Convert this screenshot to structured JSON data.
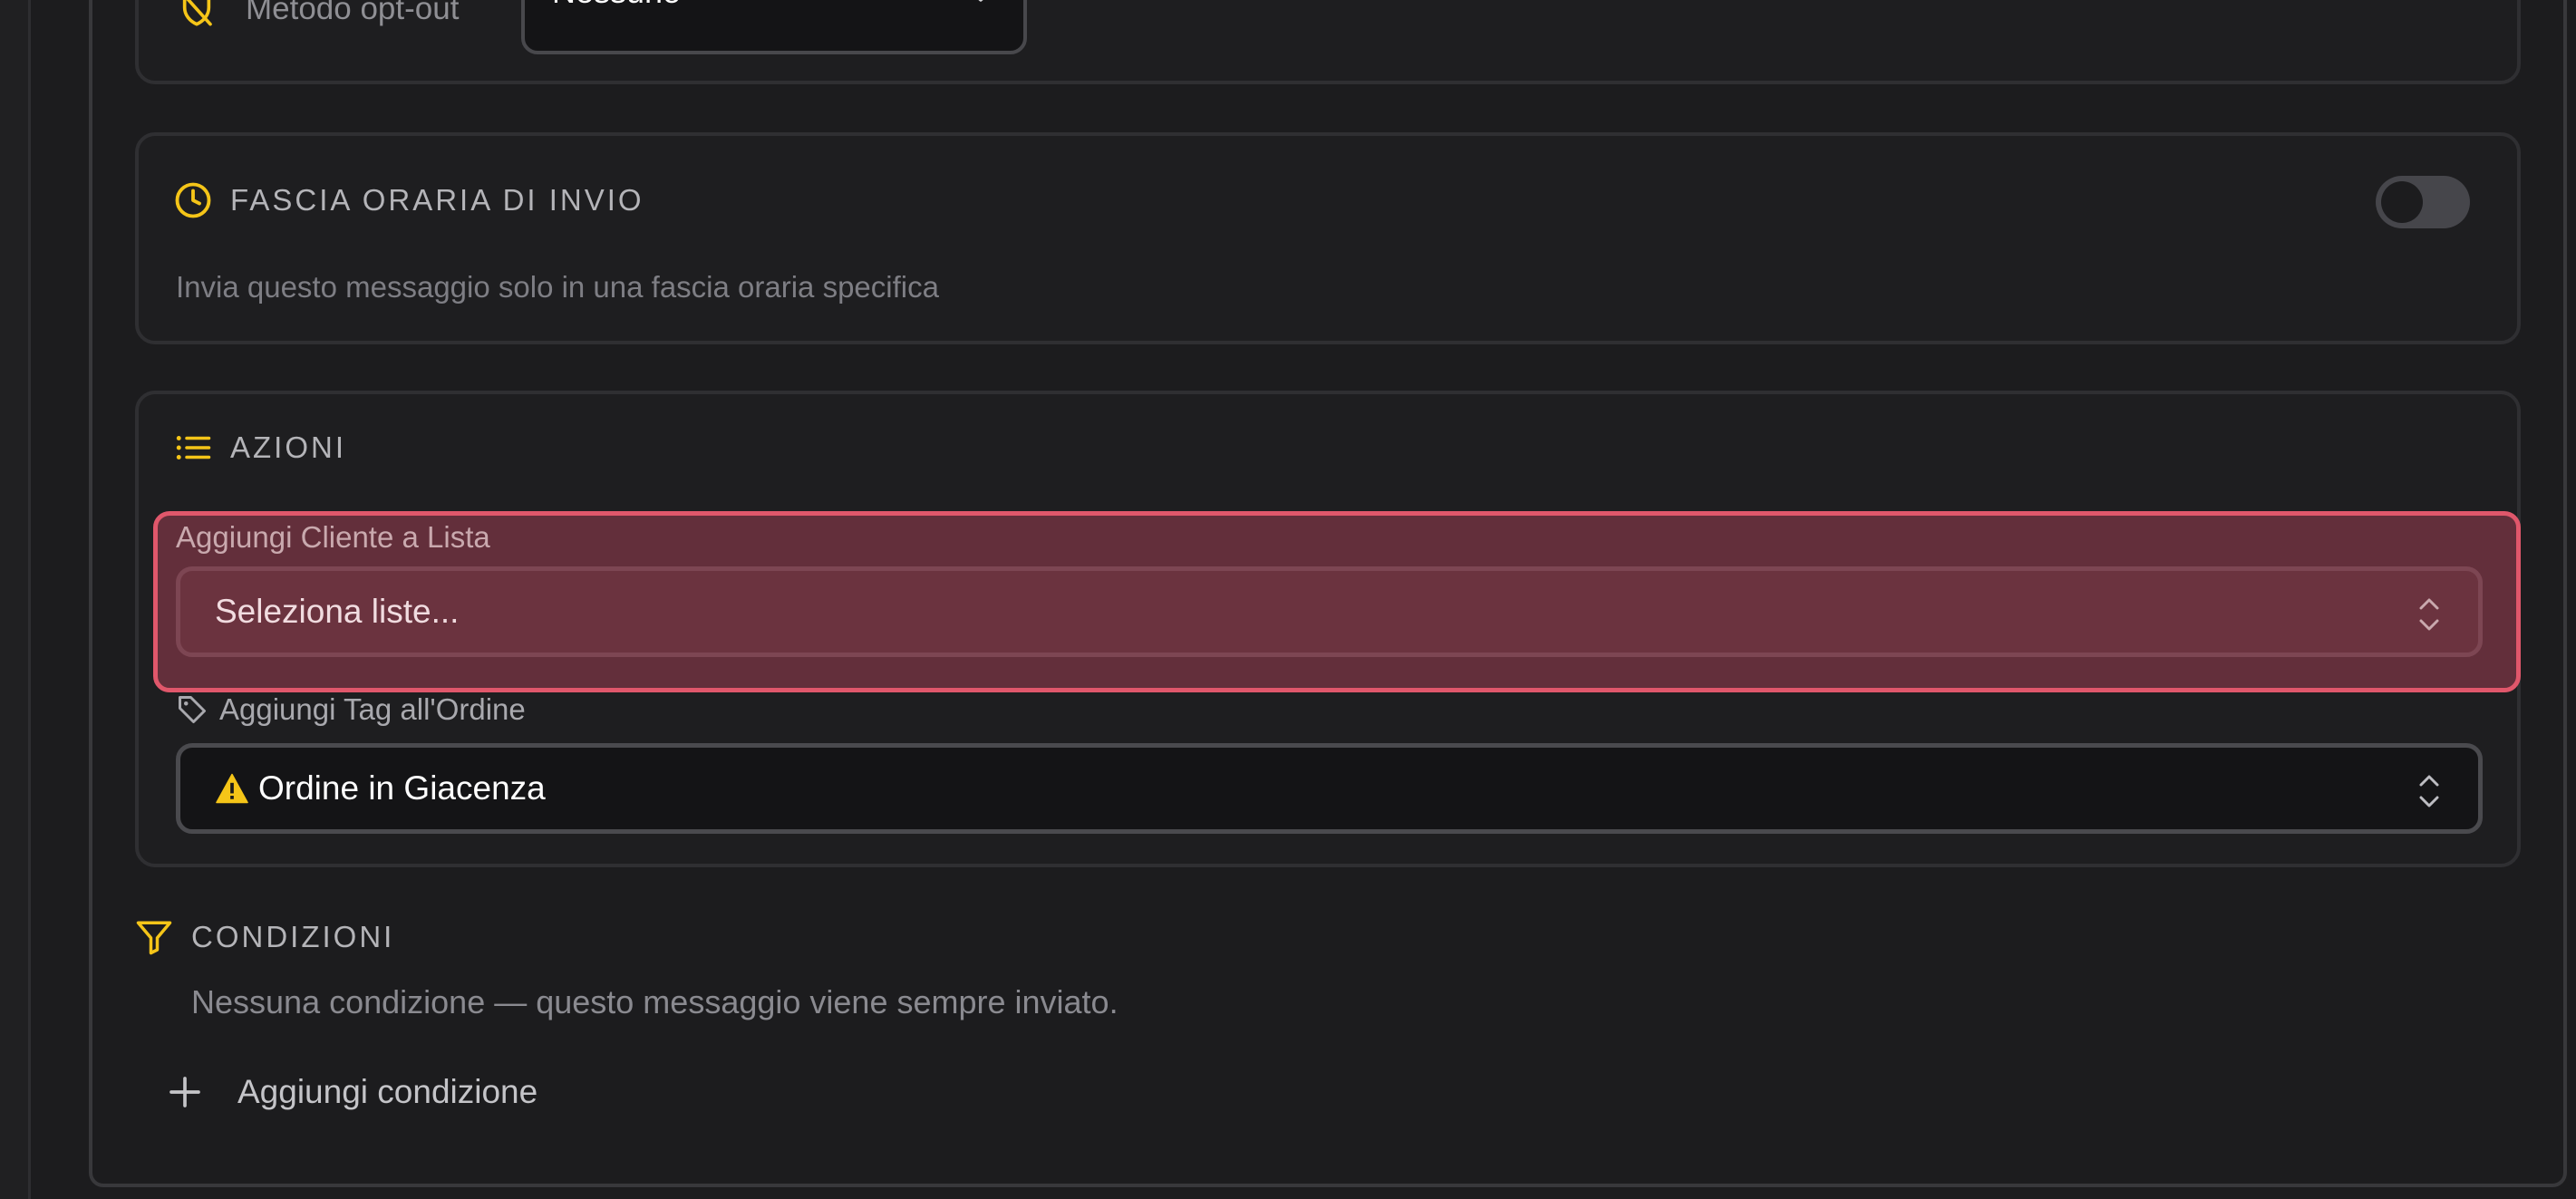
{
  "optout": {
    "label": "Metodo opt-out",
    "value": "Nessuno"
  },
  "fascia": {
    "title": "FASCIA ORARIA DI INVIO",
    "description": "Invia questo messaggio solo in una fascia oraria specifica",
    "enabled": false
  },
  "azioni": {
    "title": "AZIONI",
    "add_to_list": {
      "label": "Aggiungi Cliente a Lista",
      "placeholder": "Seleziona liste..."
    },
    "add_tag": {
      "label": "Aggiungi Tag all'Ordine",
      "value": "Ordine in Giacenza",
      "value_icon": "warning-icon"
    }
  },
  "condizioni": {
    "title": "CONDIZIONI",
    "empty_text": "Nessuna condizione — questo messaggio viene sempre inviato.",
    "add_label": "Aggiungi condizione"
  },
  "colors": {
    "accent": "#f5c518",
    "highlight_border": "#e0576b",
    "highlight_fill": "#632f3b"
  }
}
